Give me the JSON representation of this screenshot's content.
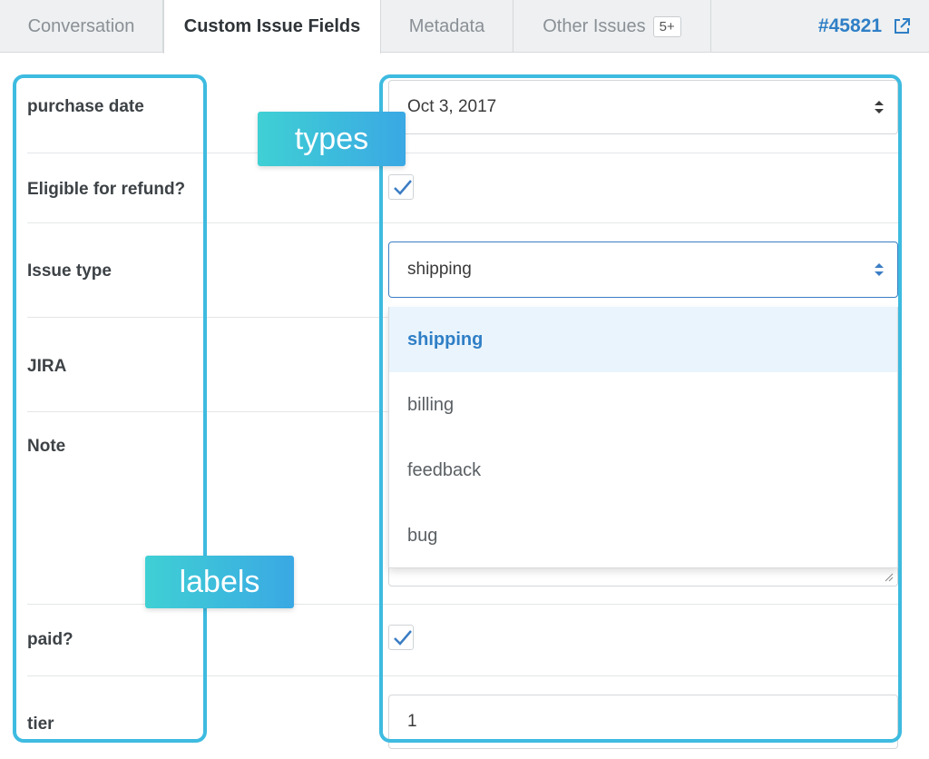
{
  "tabs": {
    "conversation": "Conversation",
    "custom_fields": "Custom Issue Fields",
    "metadata": "Metadata",
    "other_issues": "Other Issues",
    "other_issues_badge": "5+"
  },
  "issue_id": "#45821",
  "fields": {
    "purchase_date": {
      "label": "purchase date",
      "value": "Oct 3, 2017"
    },
    "refund": {
      "label": "Eligible for refund?",
      "checked": true
    },
    "issue_type": {
      "label": "Issue type",
      "value": "shipping"
    },
    "jira": {
      "label": "JIRA"
    },
    "note": {
      "label": "Note"
    },
    "paid": {
      "label": "paid?",
      "checked": true
    },
    "tier": {
      "label": "tier",
      "value": "1"
    }
  },
  "dropdown": {
    "options": [
      "shipping",
      "billing",
      "feedback",
      "bug"
    ],
    "selected": "shipping"
  },
  "annotations": {
    "types": "types",
    "labels": "labels"
  },
  "colors": {
    "accent": "#2f7fc6",
    "annotation": "#3ebbe0"
  }
}
